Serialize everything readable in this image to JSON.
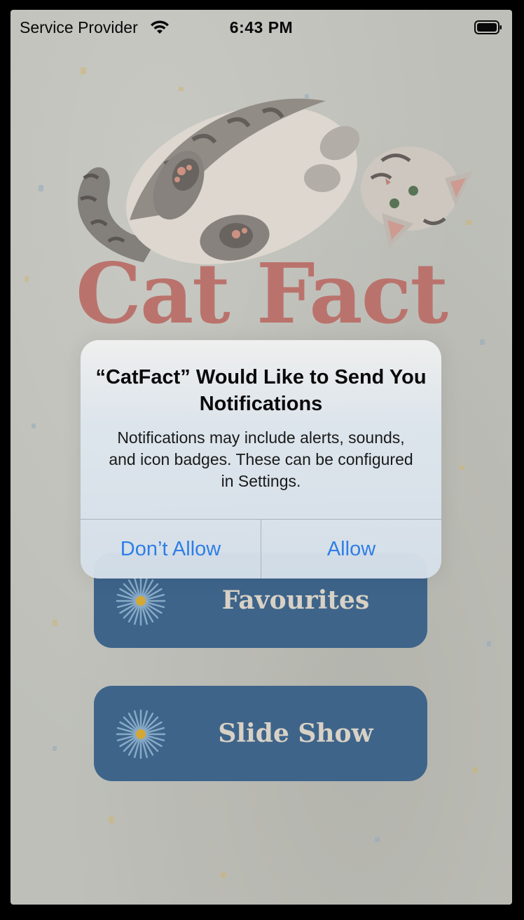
{
  "status_bar": {
    "carrier": "Service Provider",
    "time": "6:43 PM",
    "wifi_icon": "wifi-icon",
    "battery_icon": "battery-full-icon"
  },
  "app": {
    "title": "Cat Fact",
    "hero_image": "cat-illustration",
    "title_color": "#c47a72",
    "button_color": "#426a92"
  },
  "menu": {
    "items": [
      {
        "label": "Favourites",
        "icon": "flower-icon"
      },
      {
        "label": "Slide Show",
        "icon": "flower-icon"
      }
    ]
  },
  "alert": {
    "title": "“CatFact” Would Like to Send You Notifications",
    "message": "Notifications may include alerts, sounds, and icon badges. These can be configured in Settings.",
    "deny_label": "Don’t Allow",
    "allow_label": "Allow",
    "button_color": "#2f7ee6"
  }
}
